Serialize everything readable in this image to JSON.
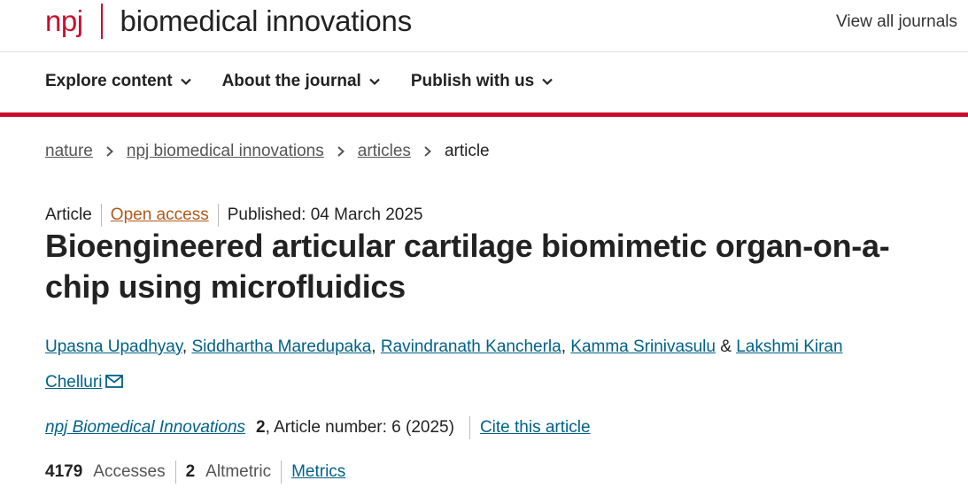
{
  "header": {
    "logo_prefix": "npj",
    "logo_name": "biomedical innovations",
    "view_all": "View all journals",
    "brand_color": "#c8102e"
  },
  "nav": {
    "items": [
      {
        "label": "Explore content"
      },
      {
        "label": "About the journal"
      },
      {
        "label": "Publish with us"
      }
    ]
  },
  "breadcrumb": {
    "items": [
      "nature",
      "npj biomedical innovations",
      "articles"
    ],
    "current": "article"
  },
  "article": {
    "type": "Article",
    "access": "Open access",
    "published": "Published: 04 March 2025",
    "title": "Bioengineered articular cartilage biomimetic organ-on-a-chip using microfluidics",
    "authors": [
      "Upasna Upadhyay",
      "Siddhartha Maredupaka",
      "Ravindranath Kancherla",
      "Kamma Srinivasulu",
      "Lakshmi Kiran Chelluri"
    ],
    "author_sep": ", ",
    "author_last_sep": " & ",
    "journal": "npj Biomedical Innovations",
    "volume": "2",
    "article_number": ", Article number: 6 (2025)",
    "cite": "Cite this article"
  },
  "metrics": {
    "accesses_value": "4179",
    "accesses_label": "Accesses",
    "altmetric_value": "2",
    "altmetric_label": "Altmetric",
    "link": "Metrics"
  },
  "colors": {
    "link": "#00618a",
    "open_access": "#b05a1b"
  }
}
